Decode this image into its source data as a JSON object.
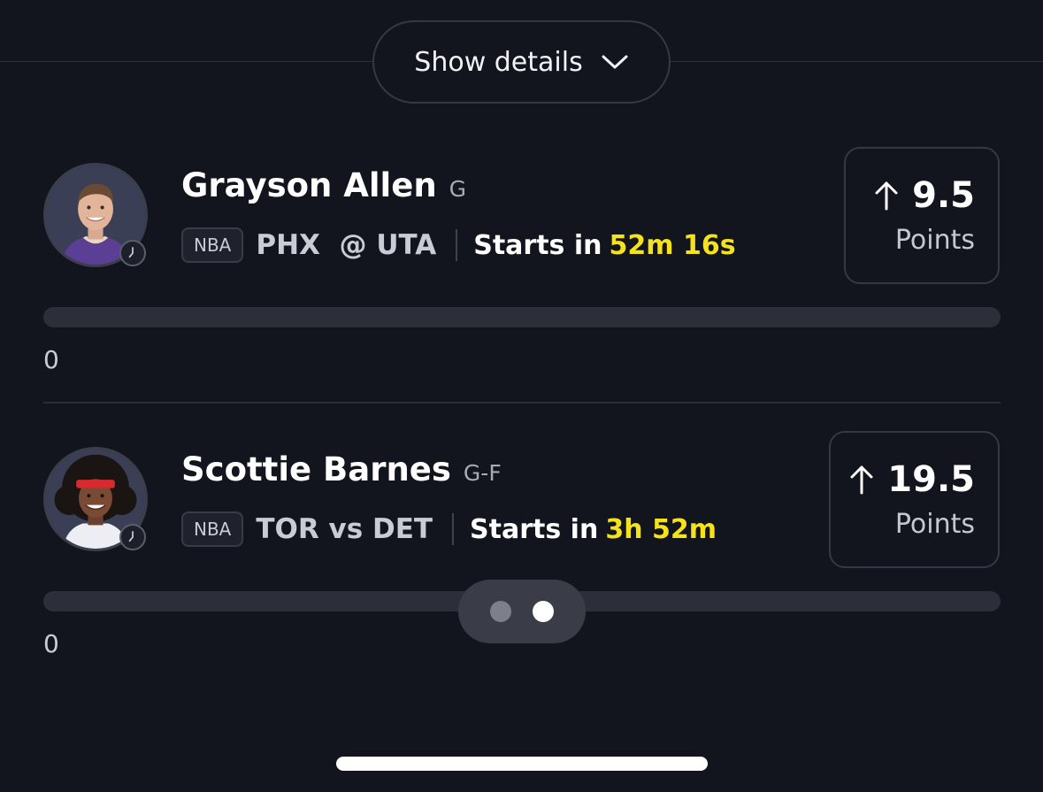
{
  "show_details": {
    "label": "Show details",
    "icon": "chevron-down-icon"
  },
  "picks": [
    {
      "player_name": "Grayson Allen",
      "position": "G",
      "league": "NBA",
      "matchup": "PHX  @ UTA",
      "starts_prefix": "Starts in",
      "countdown": "52m 16s",
      "direction_icon": "arrow-up-icon",
      "line": "9.5",
      "stat": "Points",
      "progress_value": "0",
      "progress_fraction": 0
    },
    {
      "player_name": "Scottie Barnes",
      "position": "G-F",
      "league": "NBA",
      "matchup": "TOR vs DET",
      "starts_prefix": "Starts in",
      "countdown": "3h 52m",
      "direction_icon": "arrow-up-icon",
      "line": "19.5",
      "stat": "Points",
      "progress_value": "0",
      "progress_fraction": 0
    }
  ],
  "pager": {
    "pages": 2,
    "active_index": 1
  },
  "colors": {
    "background": "#12141e",
    "accent_countdown": "#f4e21b",
    "border": "#353846",
    "track": "#2c2e39"
  }
}
